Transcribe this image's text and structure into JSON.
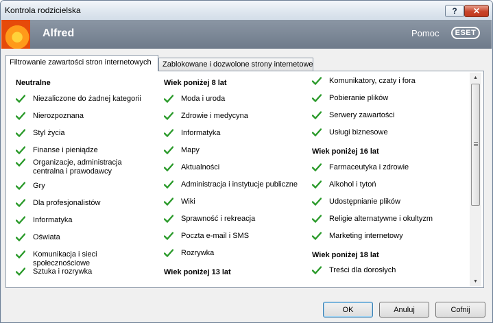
{
  "window": {
    "title": "Kontrola rodzicielska"
  },
  "titlebar": {
    "help_glyph": "?",
    "close_glyph": "✕"
  },
  "header": {
    "user_name": "Alfred",
    "help_label": "Pomoc",
    "logo_text": "eset"
  },
  "tabs": [
    {
      "label": "Filtrowanie zawartości stron internetowych",
      "active": true
    },
    {
      "label": "Zablokowane i dozwolone strony internetowe",
      "active": false
    }
  ],
  "columns": [
    {
      "heading": "Neutralne",
      "items": [
        "Niezaliczone do żadnej kategorii",
        "Nierozpoznana",
        "Styl życia",
        "Finanse i pieniądze",
        "Organizacje, administracja centralna i prawodawcy",
        "Gry",
        "Dla profesjonalistów",
        "Informatyka",
        "Oświata",
        "Komunikacja i sieci społecznościowe",
        "Sztuka i rozrywka"
      ]
    },
    {
      "heading": "Wiek poniżej 8 lat",
      "items": [
        "Moda i uroda",
        "Zdrowie i medycyna",
        "Informatyka",
        "Mapy",
        "Aktualności",
        "Administracja i instytucje publiczne",
        "Wiki",
        "Sprawność i rekreacja",
        "Poczta e-mail i SMS",
        "Rozrywka"
      ],
      "heading_after": "Wiek poniżej 13 lat"
    },
    {
      "items_top": [
        "Komunikatory, czaty i fora",
        "Pobieranie plików",
        "Serwery zawartości",
        "Usługi biznesowe"
      ],
      "heading_mid": "Wiek poniżej 16 lat",
      "items_mid": [
        "Farmaceutyka i zdrowie",
        "Alkohol i tytoń",
        "Udostępnianie plików",
        "Religie alternatywne i okultyzm",
        "Marketing internetowy"
      ],
      "heading_end": "Wiek poniżej 18 lat",
      "items_end": [
        "Treści dla dorosłych"
      ]
    }
  ],
  "buttons": {
    "ok": "OK",
    "cancel": "Anuluj",
    "back": "Cofnij"
  },
  "colors": {
    "check": "#2a9a2a",
    "header_bg": "#7a8594",
    "close_button": "#c8442a"
  },
  "icons": {
    "check": "check-icon",
    "scroll_up": "scroll-up-arrow-icon",
    "scroll_down": "scroll-down-arrow-icon",
    "avatar": "flower-avatar-icon"
  }
}
